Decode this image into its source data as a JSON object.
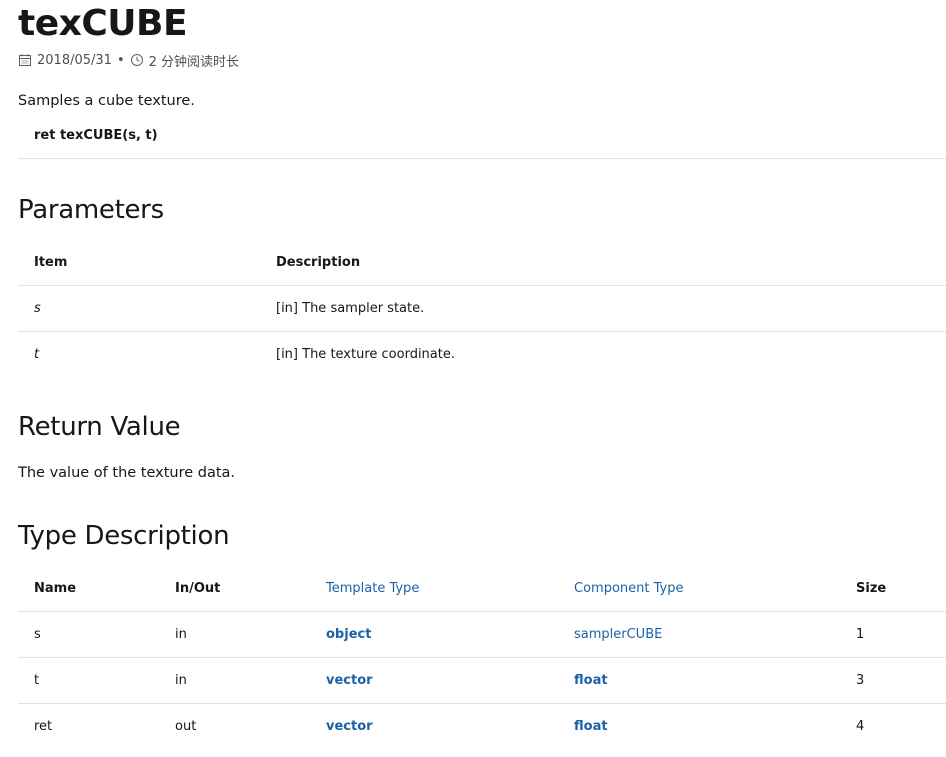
{
  "article": {
    "title": "texCUBE",
    "date": "2018/05/31",
    "separator": "•",
    "read_time": "2 分钟阅读时长",
    "icons": {
      "date": "calendar-icon",
      "time": "clock-icon"
    },
    "summary": "Samples a cube texture.",
    "syntax": "ret texCUBE(s, t)"
  },
  "parameters": {
    "heading": "Parameters",
    "columns": [
      "Item",
      "Description"
    ],
    "rows": [
      {
        "item": "s",
        "description": "[in] The sampler state."
      },
      {
        "item": "t",
        "description": "[in] The texture coordinate."
      }
    ]
  },
  "return_value": {
    "heading": "Return Value",
    "text": "The value of the texture data."
  },
  "type_description": {
    "heading": "Type Description",
    "columns": [
      "Name",
      "In/Out",
      "Template Type",
      "Component Type",
      "Size"
    ],
    "rows": [
      {
        "name": "s",
        "inout": "in",
        "template_type": "object",
        "component_type": "samplerCUBE",
        "size": "1"
      },
      {
        "name": "t",
        "inout": "in",
        "template_type": "vector",
        "component_type": "float",
        "size": "3"
      },
      {
        "name": "ret",
        "inout": "out",
        "template_type": "vector",
        "component_type": "float",
        "size": "4"
      }
    ]
  },
  "colors": {
    "link": "#1a62a8",
    "text": "#171717",
    "muted": "#505050",
    "rule": "#e3e3e3"
  }
}
